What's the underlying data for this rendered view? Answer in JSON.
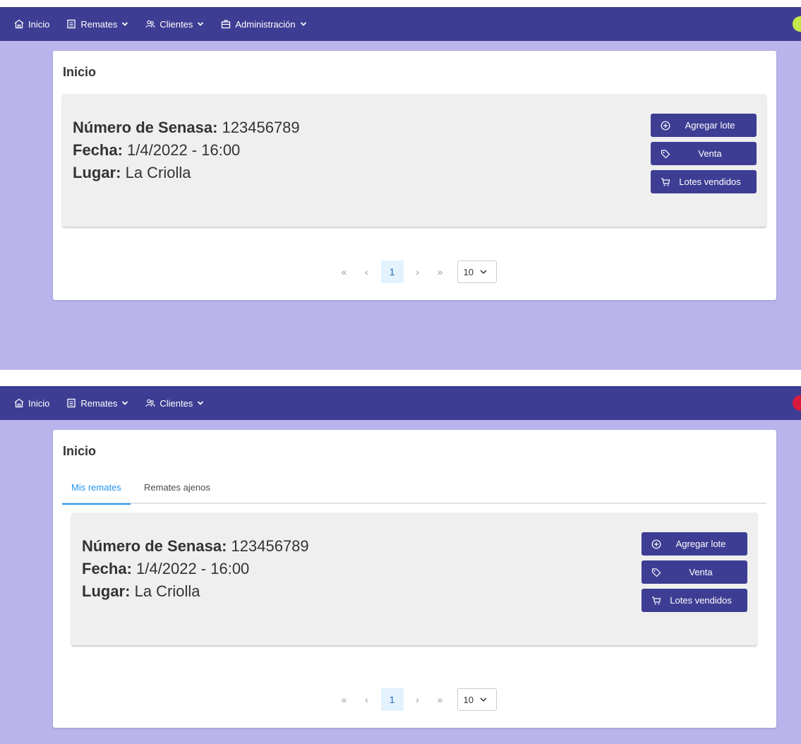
{
  "screens": [
    {
      "nav": [
        {
          "label": "Inicio",
          "icon": "home-icon"
        },
        {
          "label": "Remates",
          "icon": "document-list-icon"
        },
        {
          "label": "Clientes",
          "icon": "users-icon"
        },
        {
          "label": "Administración",
          "icon": "briefcase-icon"
        }
      ],
      "avatar_color": "#c6e84a",
      "title": "Inicio",
      "item": {
        "senasa_label": "Número de Senasa:",
        "senasa_value": "123456789",
        "fecha_label": "Fecha:",
        "fecha_value": "1/4/2022 - 16:00",
        "lugar_label": "Lugar:",
        "lugar_value": "La Criolla"
      },
      "buttons": {
        "add": "Agregar lote",
        "sale": "Venta",
        "sold": "Lotes vendidos"
      },
      "pagination": {
        "first": "«",
        "prev": "‹",
        "current": "1",
        "next": "›",
        "last": "»",
        "rows": "10"
      }
    },
    {
      "nav": [
        {
          "label": "Inicio",
          "icon": "home-icon"
        },
        {
          "label": "Remates",
          "icon": "document-list-icon"
        },
        {
          "label": "Clientes",
          "icon": "users-icon"
        }
      ],
      "avatar_color": "#d81b3c",
      "title": "Inicio",
      "tabs": [
        "Mis remates",
        "Remates ajenos"
      ],
      "item": {
        "senasa_label": "Número de Senasa:",
        "senasa_value": "123456789",
        "fecha_label": "Fecha:",
        "fecha_value": "1/4/2022 - 16:00",
        "lugar_label": "Lugar:",
        "lugar_value": "La Criolla"
      },
      "buttons": {
        "add": "Agregar lote",
        "sale": "Venta",
        "sold": "Lotes vendidos"
      },
      "pagination": {
        "first": "«",
        "prev": "‹",
        "current": "1",
        "next": "›",
        "last": "»",
        "rows": "10"
      }
    }
  ],
  "colors": {
    "navbar": "#3e3d94",
    "background": "#b9b5ec",
    "button": "#3e3d94",
    "active_tab": "#2196f3"
  }
}
